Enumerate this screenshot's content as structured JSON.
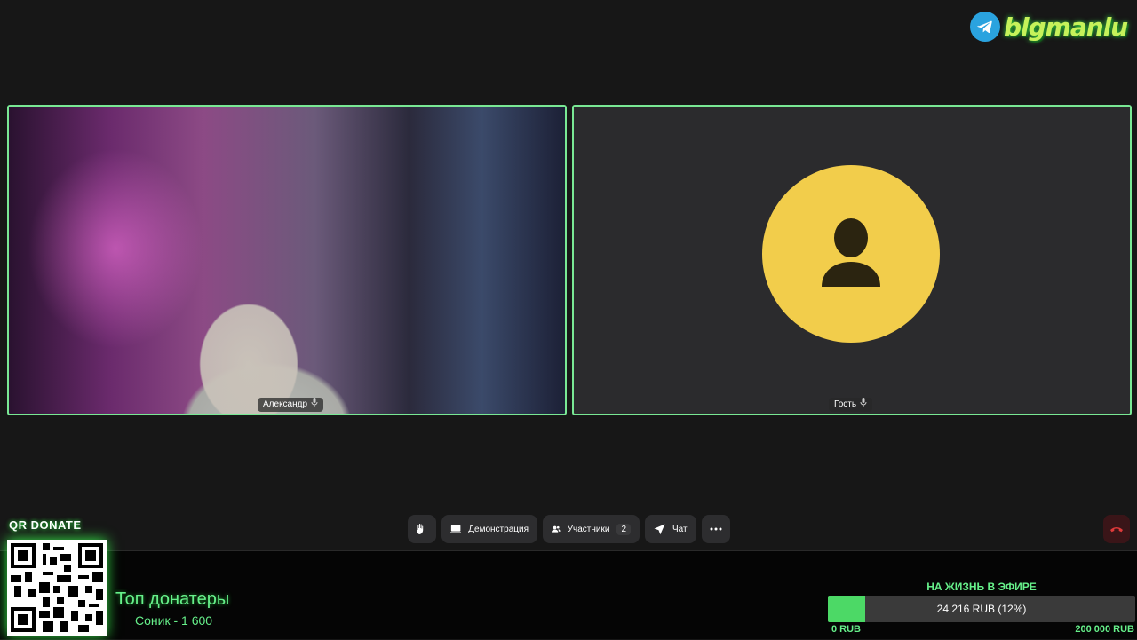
{
  "logo": {
    "text": "blgmanlu",
    "icon": "telegram-icon"
  },
  "participants": [
    {
      "name": "Александр",
      "icon": "mic-icon",
      "avatar": "video"
    },
    {
      "name": "Гость",
      "icon": "mic-icon",
      "avatar": "person-icon",
      "avatar_color": "#f2cd4b"
    }
  ],
  "toolbar": {
    "raise_hand_icon": "hand-icon",
    "demo_label": "Демонстрация",
    "participants_label": "Участники",
    "participants_count": "2",
    "chat_label": "Чат",
    "more_icon": "more-icon",
    "end_call_icon": "phone-hangup-icon"
  },
  "overlay": {
    "qr_label": "QR DONATE",
    "top_donors_title": "Топ донатеры",
    "top_donor_line": "Соник - 1 600",
    "goal_title": "НА ЖИЗНЬ В ЭФИРЕ",
    "goal_current": "24 216 RUB (12%)",
    "goal_fraction": 0.12,
    "goal_min": "0 RUB",
    "goal_max": "200 000 RUB"
  },
  "colors": {
    "accent": "#79e894",
    "overlay_green": "#66f08a",
    "end_call": "#e03a3a"
  }
}
